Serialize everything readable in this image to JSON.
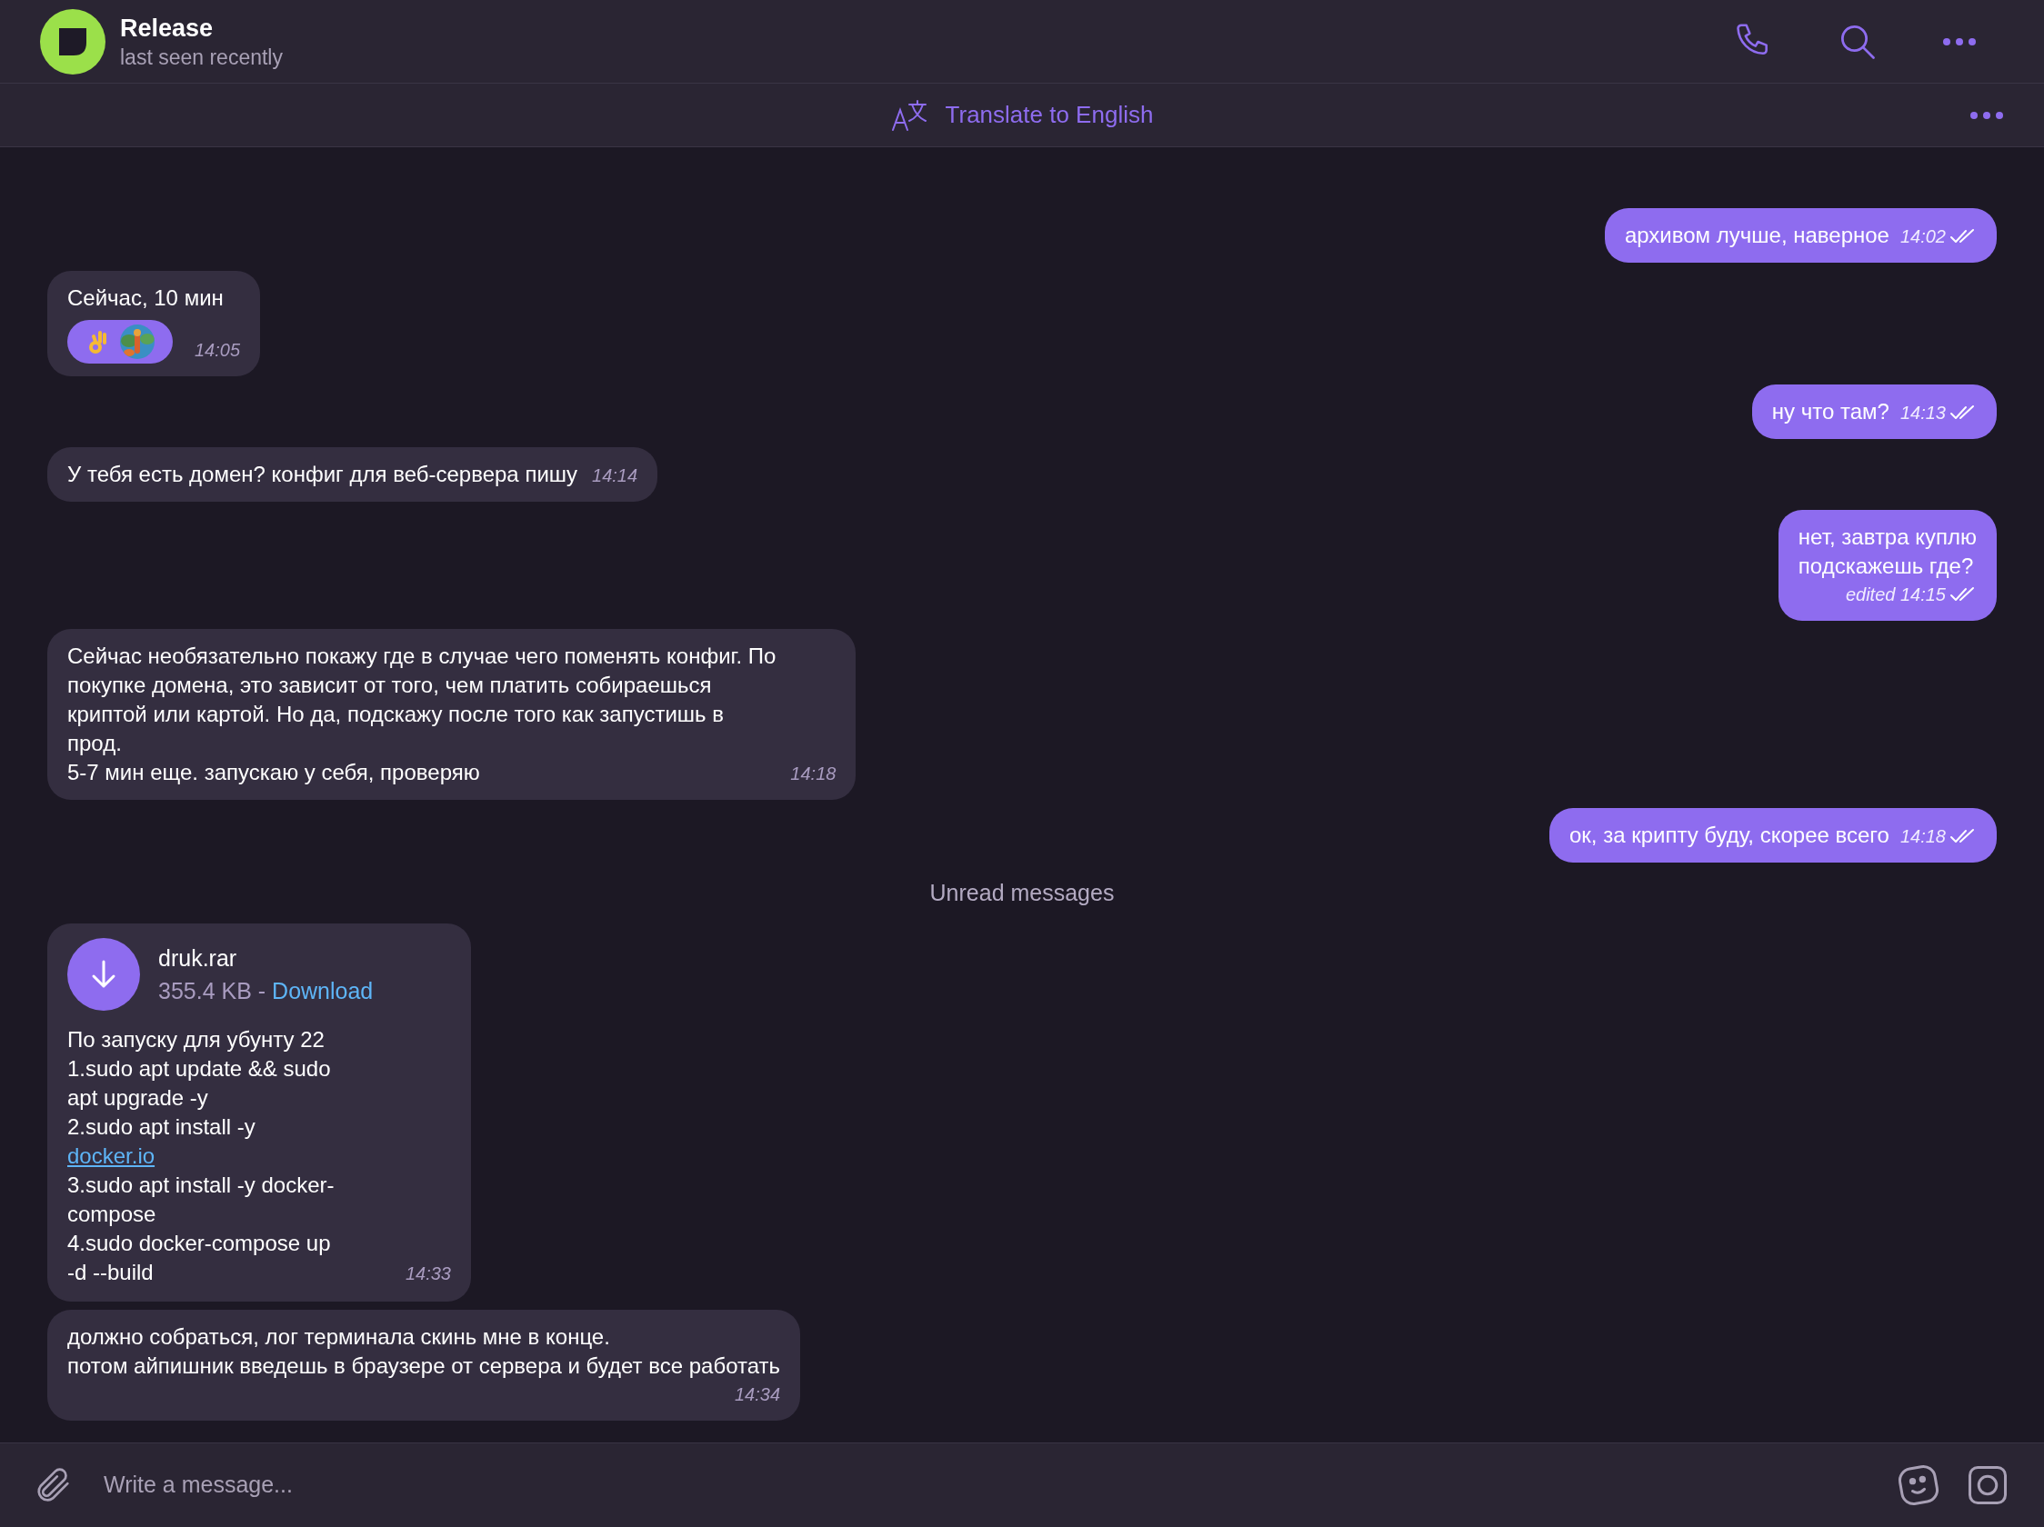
{
  "header": {
    "name": "Release",
    "status": "last seen recently"
  },
  "translate_bar": {
    "label": "Translate to English"
  },
  "messages": [
    {
      "kind": "outgoing",
      "text": "архивом лучше, наверное",
      "time": "14:02",
      "read": true
    },
    {
      "kind": "incoming",
      "text": "Сейчас, 10 мин",
      "time": "14:05",
      "reactions": [
        {
          "kind": "icon"
        },
        {
          "kind": "picture"
        }
      ]
    },
    {
      "kind": "outgoing",
      "text": "ну что там?",
      "time": "14:13",
      "read": true
    },
    {
      "kind": "incoming",
      "text": "У тебя есть домен? конфиг для веб-сервера пишу",
      "time": "14:14"
    },
    {
      "kind": "outgoing",
      "text": "нет, завтра куплю\nподскажешь где?",
      "time": "edited 14:15",
      "read": true
    },
    {
      "kind": "incoming",
      "text": "Сейчас необязательно покажу где в случае чего поменять конфиг. По\nпокупке домена, это зависит от того, чем платить собираешься\nкриптой или картой. Но да, подскажу после того как запустишь в\nпрод.\n5-7 мин еще. запускаю у себя, проверяю",
      "time": "14:18"
    },
    {
      "kind": "outgoing",
      "text": "ок, за крипту буду, скорее всего",
      "time": "14:18",
      "read": true
    },
    {
      "kind": "divider",
      "text": "Unread messages"
    },
    {
      "kind": "file",
      "file_name": "druk.rar",
      "size": "355.4 KB - ",
      "action": "Download",
      "caption": [
        {
          "kind": "text",
          "text": "По запуску для убунту 22\n1.sudo apt update && sudo\napt upgrade -y\n2.sudo apt install -y\n"
        },
        {
          "kind": "link",
          "text": "docker.io"
        },
        {
          "kind": "text",
          "text": "\n3.sudo apt install -y docker-\ncompose\n4.sudo docker-compose up\n-d --build"
        }
      ],
      "time": "14:33"
    },
    {
      "kind": "incoming",
      "text": "должно собраться, лог терминала скинь мне в конце.\nпотом айпишник введешь в браузере от сервера и будет все работать",
      "time": "14:34",
      "time_below": true
    }
  ],
  "composer": {
    "placeholder": "Write a message..."
  }
}
